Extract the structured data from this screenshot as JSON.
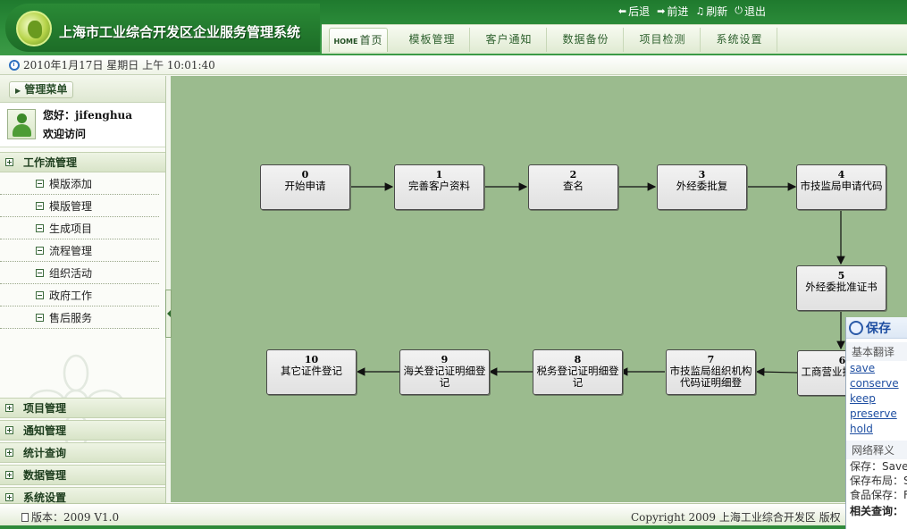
{
  "header": {
    "title": "上海市工业综合开发区企业服务管理系统",
    "actions": [
      {
        "label": "后退",
        "icon": "back-arrow-icon"
      },
      {
        "label": "前进",
        "icon": "forward-arrow-icon"
      },
      {
        "label": "刷新",
        "icon": "refresh-icon"
      },
      {
        "label": "退出",
        "icon": "power-icon"
      }
    ],
    "nav": [
      {
        "label": "首页",
        "prefix": "HOME"
      },
      {
        "label": "模板管理"
      },
      {
        "label": "客户通知"
      },
      {
        "label": "数据备份"
      },
      {
        "label": "项目检测"
      },
      {
        "label": "系统设置"
      }
    ]
  },
  "datebar": {
    "text": "2010年1月17日  星期日  上午  10:01:40"
  },
  "sidebar": {
    "menu_title": "管理菜单",
    "greeting": "您好：jifenghua",
    "welcome": "欢迎访问",
    "workflow_group": "工作流管理",
    "workflow_items": [
      "模版添加",
      "模版管理",
      "生成项目",
      "流程管理",
      "组织活动",
      "政府工作",
      "售后服务"
    ],
    "bottom_groups": [
      "项目管理",
      "通知管理",
      "统计查询",
      "数据管理",
      "系统设置"
    ]
  },
  "workflow": {
    "nodes": [
      {
        "num": "0",
        "label": "开始申请"
      },
      {
        "num": "1",
        "label": "完善客户资料"
      },
      {
        "num": "2",
        "label": "查名"
      },
      {
        "num": "3",
        "label": "外经委批复"
      },
      {
        "num": "4",
        "label": "市技监局申请代码"
      },
      {
        "num": "5",
        "label": "外经委批准证书"
      },
      {
        "num": "6",
        "label": "工商营业执照细登"
      },
      {
        "num": "7",
        "label": "市技监局组织机构代码证明细登"
      },
      {
        "num": "8",
        "label": "税务登记证明细登记"
      },
      {
        "num": "9",
        "label": "海关登记证明细登记"
      },
      {
        "num": "10",
        "label": "其它证件登记"
      }
    ]
  },
  "dictionary": {
    "word": "保存",
    "basic_title": "基本翻译",
    "translations": [
      "save",
      "conserve",
      "keep",
      "preserve",
      "hold"
    ],
    "web_title": "网络释义",
    "web_entries": [
      "保存：Save",
      "保存布局：S",
      "食品保存：F"
    ],
    "related": "相关查询："
  },
  "footer": {
    "version": "版本：2009  V1.0",
    "copyright": "Copyright  2009    上海工业综合开发区    版权"
  },
  "colors": {
    "header_green": "#2e8f3c",
    "canvas_green": "#9bbb8e",
    "node_bg": "#e8e8e8",
    "link_blue": "#1f4fa2"
  }
}
